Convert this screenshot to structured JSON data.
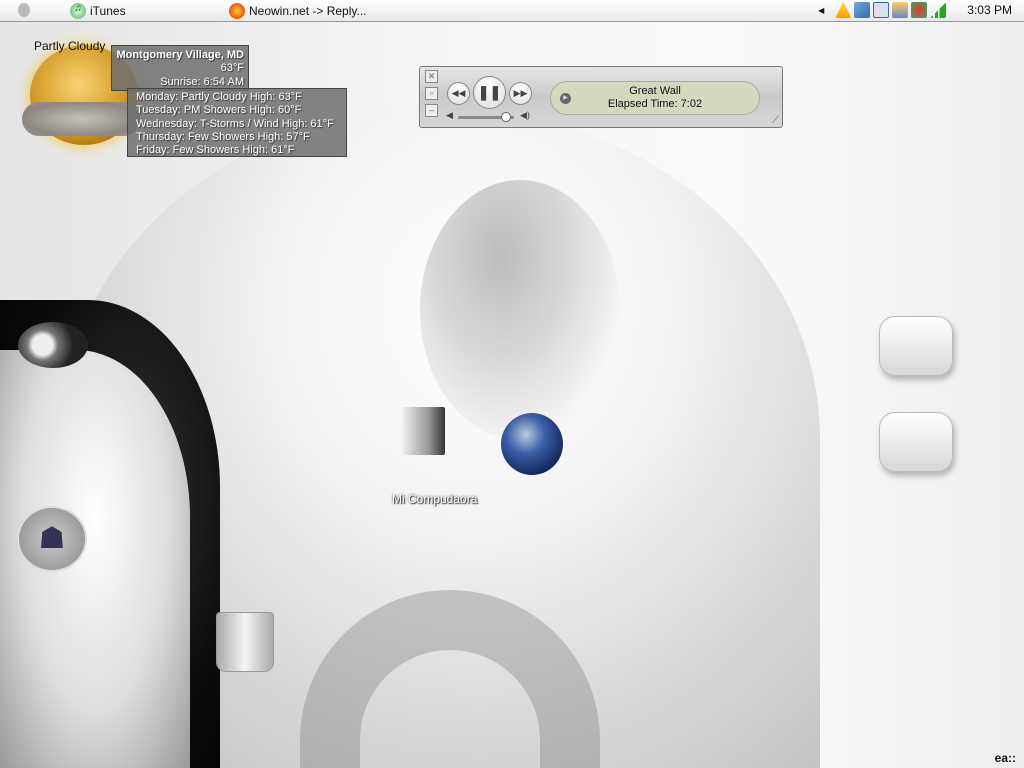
{
  "menubar": {
    "apple": "apple-icon",
    "items": [
      {
        "label": "iTunes",
        "icon": "itunes-icon"
      },
      {
        "label": "Neowin.net -> Reply...",
        "icon": "firefox-icon"
      }
    ],
    "tray": {
      "icons": [
        "chevron-left-icon",
        "warning-icon",
        "network-icon",
        "volume-icon",
        "display-icon",
        "messenger-icon",
        "signal-icon"
      ],
      "clock": "3:03 PM"
    }
  },
  "weather": {
    "condition": "Partly Cloudy",
    "location": "Montgomery Village, MD",
    "temperature": "63°F",
    "sunrise": "Sunrise: 6:54 AM",
    "forecast": [
      "Monday: Partly Cloudy High: 63°F",
      "Tuesday: PM Showers High: 60°F",
      "Wednesday: T-Storms / Wind High: 61°F",
      "Thursday: Few Showers High: 57°F",
      "Friday: Few Showers High: 61°F"
    ]
  },
  "player": {
    "track": "Great Wall",
    "elapsed": "Elapsed Time: 7:02",
    "volume": 0.85
  },
  "desktop": {
    "my_computer_label": "Mi Compudaora"
  },
  "signature": "ea::"
}
